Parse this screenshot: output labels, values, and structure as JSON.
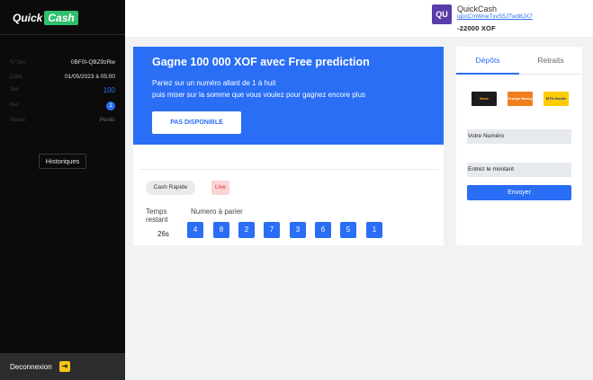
{
  "sidebar": {
    "logo_quick": "Quick",
    "logo_cash": "Cash",
    "fields": [
      {
        "key": "N°Jeu",
        "value": "0BF0I-QBZ9zRw"
      },
      {
        "key": "Date",
        "value": "01/05/2023 à 05:00"
      },
      {
        "key": "Set",
        "value": "100"
      },
      {
        "key": "Bet",
        "value": "1"
      },
      {
        "key": "Statut",
        "value": "Perdu"
      }
    ],
    "historiques_label": "Historiques",
    "logout_label": "Deconnexion"
  },
  "header": {
    "avatar_initials": "QU",
    "username": "QuickCash",
    "user_id": "iqocCmWneTxvS5JTwd8JX7",
    "balance": "-22000 XOF"
  },
  "main": {
    "banner_title": "Gagne 100 000 XOF avec Free prediction",
    "banner_line1": "Pariez sur un numéro allant de 1 à huit",
    "banner_line2": "puis miser sur la somme que vous voulez pour gagnez encore plus",
    "dispo_button": "PAS DISPONIBLE",
    "chip_cash": "Cash Rapide",
    "chip_live": "Live",
    "temps_line1": "Temps",
    "temps_line2": "restant",
    "temps_value": "26s",
    "numero_label": "Numero à parier",
    "numbers": [
      "4",
      "8",
      "2",
      "7",
      "3",
      "6",
      "5",
      "1"
    ]
  },
  "side": {
    "tab_depots": "Dépôts",
    "tab_retraits": "Retraits",
    "pay_wave": "Wave",
    "pay_orange": "Orange Money",
    "pay_mtn": "MTN Mobile Money",
    "numero_placeholder": "Votre Numéro",
    "montant_placeholder": "Entrez le montant",
    "send_button": "Envoyer"
  },
  "colors": {
    "accent": "#2a6ef5",
    "sidebar_bg": "#0b0b0b",
    "logo_green": "#2ec06b",
    "live_red": "#e02c2c"
  }
}
